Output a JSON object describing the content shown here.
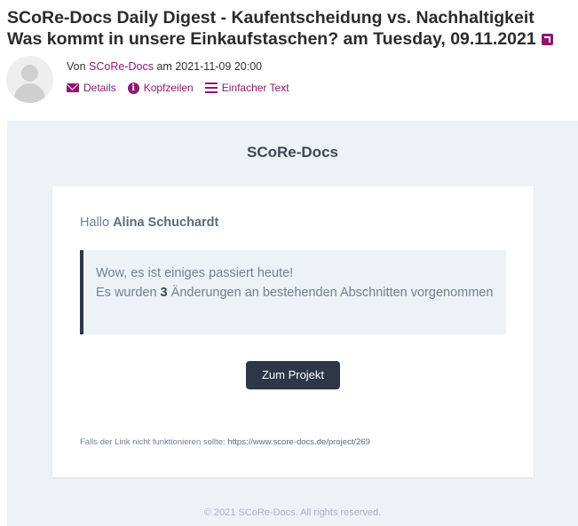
{
  "email": {
    "subject": "SCoRe-Docs Daily Digest - Kaufentscheidung vs. Nachhaltigkeit Was kommt in unsere Einkaufstaschen? am Tuesday, 09.11.2021",
    "from_prefix": "Von",
    "from_name": "SCoRe-Docs",
    "date_prefix": "am",
    "date": "2021-11-09 20:00",
    "actions": [
      {
        "label": "Details",
        "icon": "envelope-icon"
      },
      {
        "label": "Kopfzeilen",
        "icon": "info-icon"
      },
      {
        "label": "Einfacher Text",
        "icon": "lines-icon"
      }
    ]
  },
  "message": {
    "brand": "SCoRe-Docs",
    "greeting_prefix": "Hallo",
    "recipient": "Alina Schuchardt",
    "panel_line1": "Wow, es ist einiges passiert heute!",
    "panel_line2_prefix": "Es wurden",
    "panel_count": "3",
    "panel_line2_suffix": "Änderungen an bestehenden Abschnitten vorgenommen",
    "button_label": "Zum Projekt",
    "fallback_text": "Falls der Link nicht funktionieren sollte:",
    "fallback_url": "https://www.score-docs.de/project/269",
    "footer": "© 2021 SCoRe-Docs. All rights reserved."
  },
  "colors": {
    "accent": "#8f1774",
    "button": "#2d3748",
    "mail_bg": "#edf2f7"
  }
}
